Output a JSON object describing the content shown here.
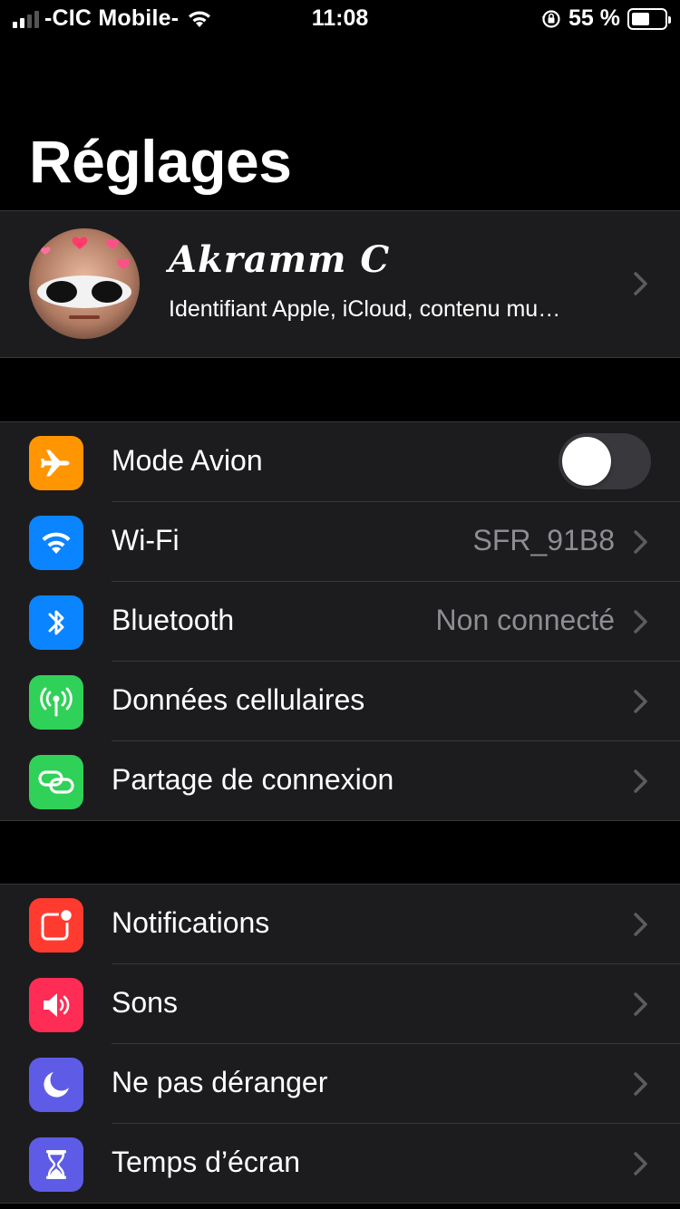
{
  "status_bar": {
    "carrier": "-CIC Mobile-",
    "time": "11:08",
    "battery_percent": "55 %",
    "battery_level": 0.55,
    "signal_bars": 2
  },
  "title": "Réglages",
  "profile": {
    "name": "Akramm C",
    "subtitle": "Identifiant Apple, iCloud, contenu mu…"
  },
  "group1": {
    "airplane": {
      "label": "Mode Avion",
      "toggle_on": false,
      "icon": "airplane-icon",
      "color": "#ff9500"
    },
    "wifi": {
      "label": "Wi-Fi",
      "value": "SFR_91B8",
      "icon": "wifi-icon",
      "color": "#0a84ff"
    },
    "bluetooth": {
      "label": "Bluetooth",
      "value": "Non connecté",
      "icon": "bluetooth-icon",
      "color": "#0a84ff"
    },
    "cellular": {
      "label": "Données cellulaires",
      "icon": "cellular-antenna-icon",
      "color": "#30d158"
    },
    "hotspot": {
      "label": "Partage de connexion",
      "icon": "hotspot-chain-icon",
      "color": "#30d158"
    }
  },
  "group2": {
    "notifications": {
      "label": "Notifications",
      "icon": "notifications-icon",
      "color": "#ff3b30"
    },
    "sounds": {
      "label": "Sons",
      "icon": "speaker-icon",
      "color": "#ff2d55"
    },
    "dnd": {
      "label": "Ne pas déranger",
      "icon": "moon-icon",
      "color": "#5e5ce6"
    },
    "screentime": {
      "label": "Temps d’écran",
      "icon": "hourglass-icon",
      "color": "#5e5ce6"
    }
  }
}
